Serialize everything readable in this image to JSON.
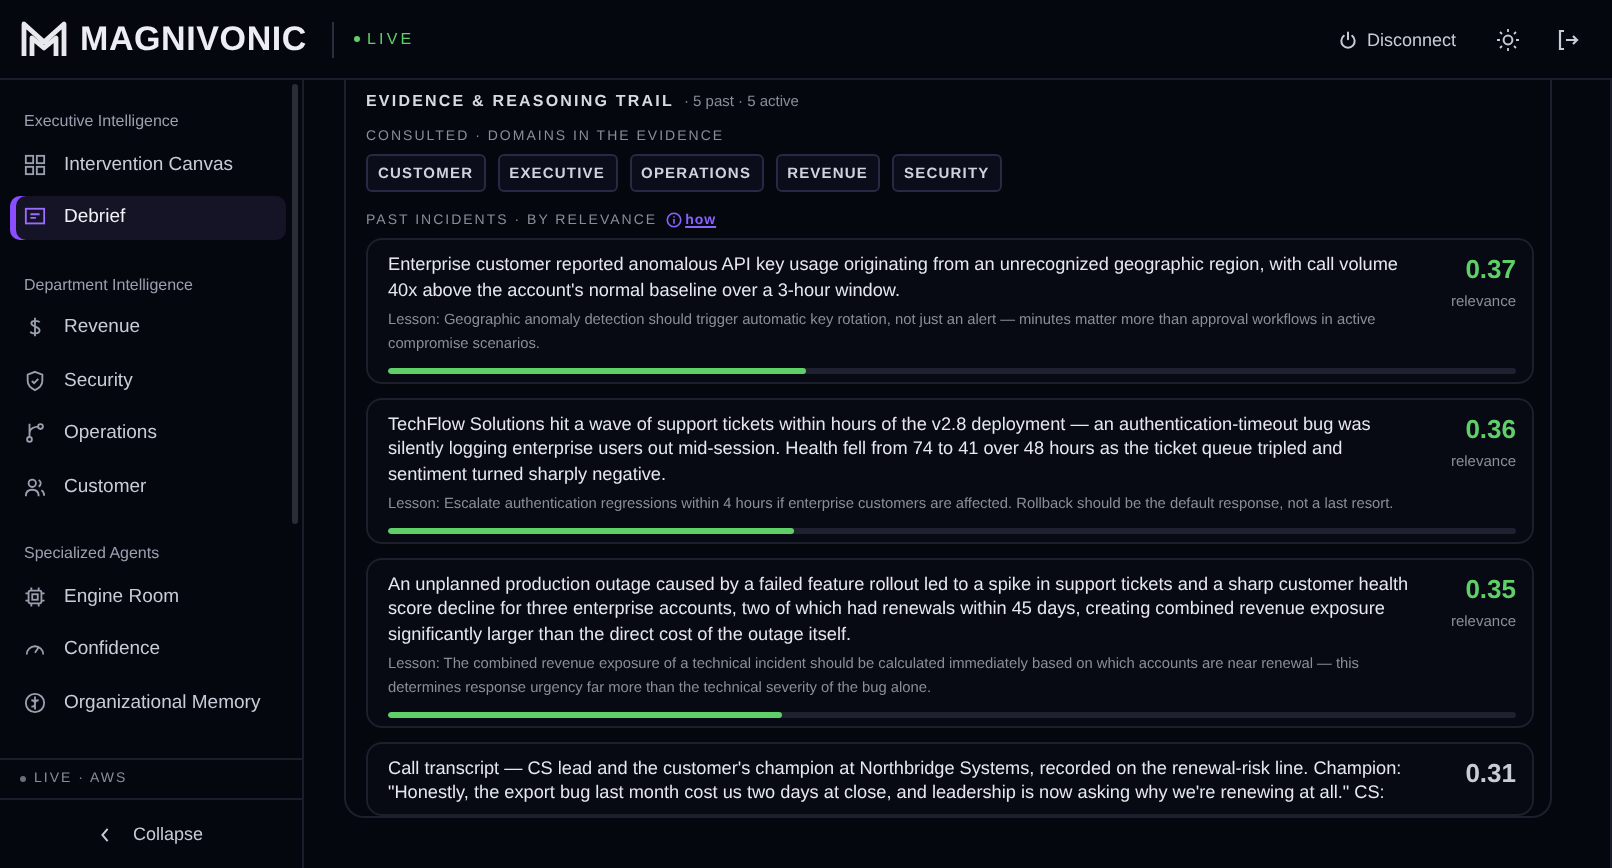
{
  "header": {
    "brand": "MAGNIVONIC",
    "status": "LIVE",
    "disconnect": "Disconnect"
  },
  "sidebar": {
    "sections": [
      {
        "title": "Executive Intelligence",
        "items": [
          {
            "label": "Intervention Canvas",
            "selected": false
          },
          {
            "label": "Debrief",
            "selected": true
          }
        ]
      },
      {
        "title": "Department Intelligence",
        "items": [
          {
            "label": "Revenue",
            "selected": false
          },
          {
            "label": "Security",
            "selected": false
          },
          {
            "label": "Operations",
            "selected": false
          },
          {
            "label": "Customer",
            "selected": false
          }
        ]
      },
      {
        "title": "Specialized Agents",
        "items": [
          {
            "label": "Engine Room",
            "selected": false
          },
          {
            "label": "Confidence",
            "selected": false
          },
          {
            "label": "Organizational Memory",
            "selected": false
          }
        ]
      }
    ],
    "footer_status": "LIVE · AWS",
    "collapse": "Collapse"
  },
  "trail": {
    "title": "EVIDENCE & REASONING TRAIL",
    "counts": "· 5 past · 5 active",
    "consulted_label": "CONSULTED · DOMAINS IN THE EVIDENCE",
    "domains": [
      "CUSTOMER",
      "EXECUTIVE",
      "OPERATIONS",
      "REVENUE",
      "SECURITY"
    ],
    "incidents_label": "PAST INCIDENTS · BY RELEVANCE",
    "how_link": "how",
    "incidents": [
      {
        "text": "Enterprise customer reported anomalous API key usage originating from an unrecognized geographic region, with call volume 40x above the account's normal baseline over a 3-hour window.",
        "lesson": "Lesson: Geographic anomaly detection should trigger automatic key rotation, not just an alert — minutes matter more than approval workflows in active compromise scenarios.",
        "score": "0.37",
        "score_label": "relevance",
        "level": 0.37,
        "color": "#5fd068"
      },
      {
        "text": "TechFlow Solutions hit a wave of support tickets within hours of the v2.8 deployment — an authentication-timeout bug was silently logging enterprise users out mid-session. Health fell from 74 to 41 over 48 hours as the ticket queue tripled and sentiment turned sharply negative.",
        "lesson": "Lesson: Escalate authentication regressions within 4 hours if enterprise customers are affected. Rollback should be the default response, not a last resort.",
        "score": "0.36",
        "score_label": "relevance",
        "level": 0.36,
        "color": "#5fd068"
      },
      {
        "text": "An unplanned production outage caused by a failed feature rollout led to a spike in support tickets and a sharp customer health score decline for three enterprise accounts, two of which had renewals within 45 days, creating combined revenue exposure significantly larger than the direct cost of the outage itself.",
        "lesson": "Lesson: The combined revenue exposure of a technical incident should be calculated immediately based on which accounts are near renewal — this determines response urgency far more than the technical severity of the bug alone.",
        "score": "0.35",
        "score_label": "relevance",
        "level": 0.35,
        "color": "#5fd068"
      },
      {
        "text": "Call transcript — CS lead and the customer's champion at Northbridge Systems, recorded on the renewal-risk line. Champion: \"Honestly, the export bug last month cost us two days at close, and leadership is now asking why we're renewing at all.\" CS:",
        "score": "0.31",
        "color": "#c9ccd6"
      }
    ]
  }
}
